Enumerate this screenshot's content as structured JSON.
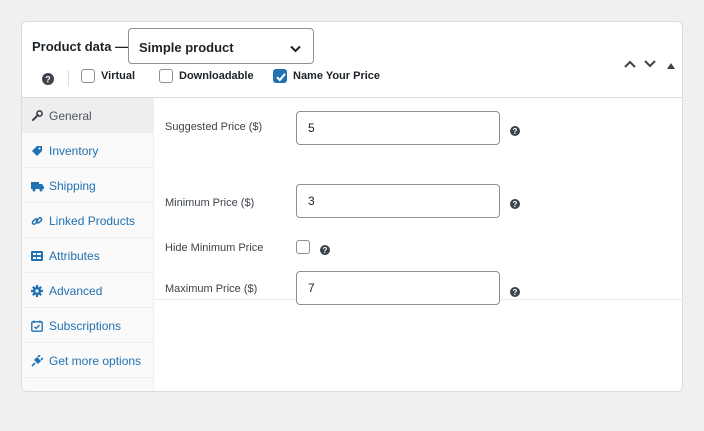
{
  "header": {
    "product_data_label": "Product data —",
    "product_type": {
      "selected": "Simple product"
    },
    "options": [
      {
        "label": "Virtual",
        "checked": false
      },
      {
        "label": "Downloadable",
        "checked": false
      },
      {
        "label": "Name Your Price",
        "checked": true
      }
    ],
    "controls": [
      "move-up",
      "move-down",
      "toggle"
    ]
  },
  "sidebar": {
    "tabs": [
      {
        "label": "General",
        "icon": "wrench-icon",
        "active": true
      },
      {
        "label": "Inventory",
        "icon": "tag-icon",
        "active": false
      },
      {
        "label": "Shipping",
        "icon": "truck-icon",
        "active": false
      },
      {
        "label": "Linked Products",
        "icon": "link-icon",
        "active": false
      },
      {
        "label": "Attributes",
        "icon": "list-icon",
        "active": false
      },
      {
        "label": "Advanced",
        "icon": "gear-icon",
        "active": false
      },
      {
        "label": "Subscriptions",
        "icon": "calendar-icon",
        "active": false
      },
      {
        "label": "Get more options",
        "icon": "plugin-icon",
        "active": false
      }
    ]
  },
  "fields": {
    "suggested_price": {
      "label": "Suggested Price ($)",
      "value": "5"
    },
    "minimum_price": {
      "label": "Minimum Price ($)",
      "value": "3"
    },
    "hide_minimum_price": {
      "label": "Hide Minimum Price",
      "checked": false
    },
    "maximum_price": {
      "label": "Maximum Price ($)",
      "value": "7"
    }
  },
  "colors": {
    "accent": "#2271b1",
    "text": "#1d2327",
    "border": "#dcdcde",
    "background": "#f0f0f1"
  }
}
